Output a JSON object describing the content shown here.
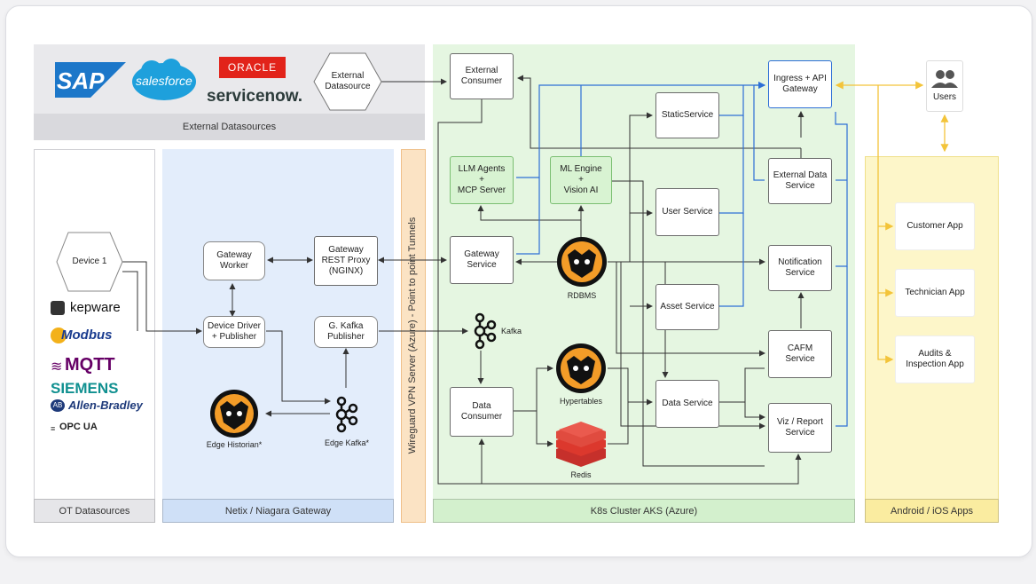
{
  "regions": {
    "external_datasources": "External Datasources",
    "ot_datasources": "OT Datasources",
    "netix_gateway": "Netix  / Niagara Gateway",
    "vpn": "Wireguard VPN Server (Azure) - Point to point Tunnels",
    "k8s": "K8s Cluster AKS (Azure)",
    "apps": "Android / iOS Apps"
  },
  "logos": {
    "sap": "SAP",
    "salesforce": "salesforce",
    "oracle": "ORACLE",
    "servicenow": "servicenow.",
    "kepware": "kepware",
    "modbus": "Modbus",
    "mqtt": "MQTT",
    "siemens": "SIEMENS",
    "allen_bradley": "Allen-Bradley",
    "opcua": "OPC UA"
  },
  "nodes": {
    "external_datasource": "External\nDatasource",
    "device1": "Device 1",
    "gateway_worker": "Gateway\nWorker",
    "gateway_rest_proxy": "Gateway\nREST Proxy\n(NGINX)",
    "device_driver": "Device Driver\n+ Publisher",
    "g_kafka_publisher": "G. Kafka\nPublisher",
    "edge_historian": "Edge Historian*",
    "edge_kafka": "Edge Kafka*",
    "external_consumer": "External\nConsumer",
    "llm_agents": "LLM Agents\n+\nMCP Server",
    "ml_engine": "ML Engine\n+\nVision AI",
    "gateway_service": "Gateway\nService",
    "rdbms": "RDBMS",
    "kafka": "Kafka",
    "data_consumer": "Data\nConsumer",
    "hypertables": "Hypertables",
    "redis": "Redis",
    "static_service": "StaticService",
    "user_service": "User Service",
    "asset_service": "Asset Service",
    "data_service": "Data Service",
    "ingress": "Ingress + API\nGateway",
    "external_data_service": "External Data\nService",
    "notification_service": "Notification\nService",
    "cafm_service": "CAFM\nService",
    "viz_report_service": "Viz / Report\nService",
    "users": "Users",
    "customer_app": "Customer App",
    "technician_app": "Technician App",
    "audits_app": "Audits &\nInspection App"
  },
  "colors": {
    "external_bg": "#e9e9ec",
    "ot_bg": "#ffffff",
    "netix_bg": "#e3edfb",
    "vpn_bg": "#fbe3c4",
    "k8s_bg": "#e5f6e1",
    "apps_bg": "#fdf6c9",
    "blue_line": "#2d6fd6",
    "yellow_line": "#f3c43a",
    "dark_line": "#333333",
    "sap_blue": "#1c77c9",
    "salesforce_blue": "#1ea0dc",
    "oracle_red": "#e2231a"
  }
}
